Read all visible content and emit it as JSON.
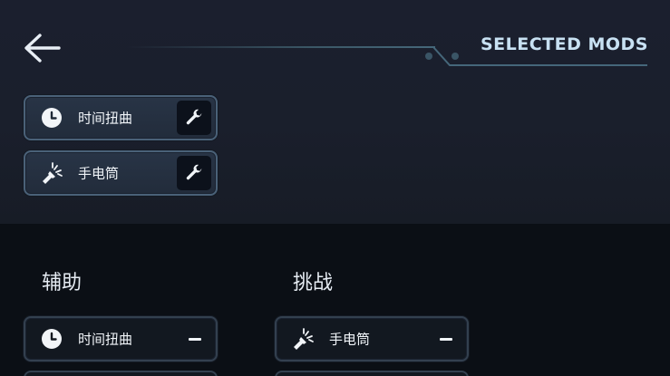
{
  "header": {
    "title": "SELECTED MODS"
  },
  "selected_mods": [
    {
      "label": "时间扭曲",
      "icon": "clock-icon"
    },
    {
      "label": "手电筒",
      "icon": "flashlight-icon"
    }
  ],
  "sections": [
    {
      "title": "辅助",
      "mods": [
        {
          "label": "时间扭曲",
          "icon": "clock-icon"
        }
      ]
    },
    {
      "title": "挑战",
      "mods": [
        {
          "label": "手电筒",
          "icon": "flashlight-icon"
        }
      ]
    }
  ],
  "colors": {
    "title": "#c8e1f3",
    "card_border": "#4a6178",
    "card_fill": "#283446",
    "bottom_bg": "#0b0f15"
  }
}
